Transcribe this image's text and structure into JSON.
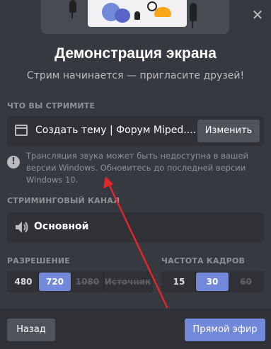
{
  "modal": {
    "title": "Демонстрация экрана",
    "subtitle": "Стрим начинается — пригласите друзей!",
    "close_icon": "close-icon"
  },
  "stream_source": {
    "section_label": "ЧТО ВЫ СТРИМИТЕ",
    "icon": "window-icon",
    "name": "Создать тему | Форум Miped....",
    "change_button": "Изменить"
  },
  "warning": {
    "icon": "exclamation-icon",
    "text": "Трансляция звука может быть недоступна в вашей версии Windows. Обновитесь до последней версии Windows 10."
  },
  "channel": {
    "section_label": "СТРИМИНГОВЫЙ КАНАЛ",
    "icon": "speaker-icon",
    "name": "Основной"
  },
  "resolution": {
    "section_label": "РАЗРЕШЕНИЕ",
    "options": [
      {
        "label": "480",
        "state": "normal"
      },
      {
        "label": "720",
        "state": "selected"
      },
      {
        "label": "1080",
        "state": "disabled"
      },
      {
        "label": "Источник",
        "state": "disabled"
      }
    ]
  },
  "framerate": {
    "section_label": "ЧАСТОТА КАДРОВ",
    "options": [
      {
        "label": "15",
        "state": "normal"
      },
      {
        "label": "30",
        "state": "selected"
      },
      {
        "label": "60",
        "state": "disabled"
      }
    ]
  },
  "footer": {
    "back_button": "Назад",
    "go_live_button": "Прямой эфир"
  },
  "colors": {
    "background": "#36393f",
    "accent": "#7289da",
    "annotation_arrow": "#e3262b"
  }
}
